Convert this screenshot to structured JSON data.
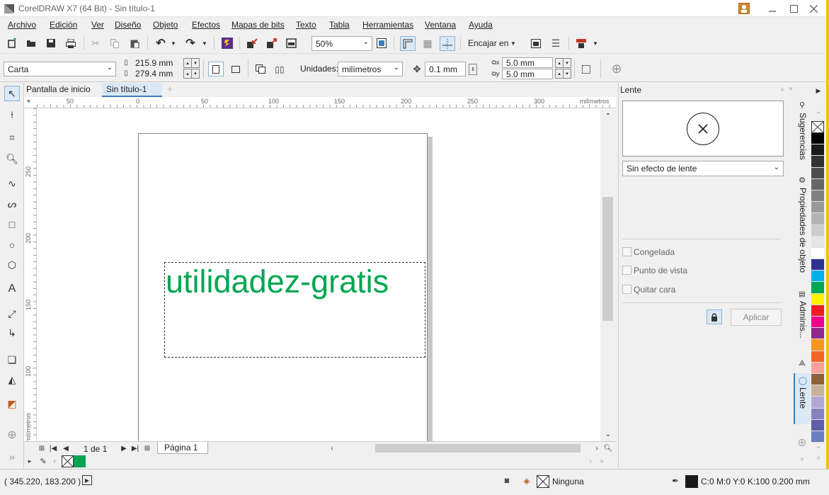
{
  "window": {
    "title": "CorelDRAW X7 (64 Bit) - Sin título-1"
  },
  "menu": [
    "Archivo",
    "Edición",
    "Ver",
    "Diseño",
    "Objeto",
    "Efectos",
    "Mapas de bits",
    "Texto",
    "Tabla",
    "Herramientas",
    "Ventana",
    "Ayuda"
  ],
  "toolbar": {
    "zoom": "50%",
    "snap_label": "Encajar en"
  },
  "propbar": {
    "paper": "Carta",
    "width": "215.9 mm",
    "height": "279.4 mm",
    "units_label": "Unidades:",
    "units_value": "milímetros",
    "nudge": "0.1 mm",
    "dup_x": "5.0 mm",
    "dup_y": "5.0 mm"
  },
  "tabs": {
    "home": "Pantalla de inicio",
    "doc": "Sin título-1"
  },
  "ruler": {
    "unit": "milímetros",
    "h_ticks": [
      "50",
      "0",
      "50",
      "100",
      "150",
      "200",
      "250",
      "300"
    ],
    "v_ticks": [
      "250",
      "200",
      "150",
      "100"
    ]
  },
  "canvas": {
    "text": "utilidadez-gratis",
    "text_color": "#00a651"
  },
  "pagenav": {
    "pages": "1 de 1",
    "page_tab": "Página 1"
  },
  "docker": {
    "title": "Lente",
    "dropdown": "Sin efecto de lente",
    "frozen": "Congelada",
    "viewpoint": "Punto de vista",
    "remove_face": "Quitar cara",
    "apply": "Aplicar"
  },
  "sidetabs": {
    "hints": "Sugerencias",
    "props": "Propiedades de objeto",
    "admin": "Adminis...",
    "lens": "Lente"
  },
  "status": {
    "coords": "( 345.220, 183.200 )",
    "fill_label": "Ninguna",
    "outline": "C:0 M:0 Y:0 K:100  0.200 mm"
  },
  "palette_colors": [
    "#ffffff",
    "#000000",
    "#1a1a1a",
    "#333333",
    "#4d4d4d",
    "#666666",
    "#808080",
    "#999999",
    "#b3b3b3",
    "#cccccc",
    "#e6e6e6",
    "#ffffff",
    "#2e3192",
    "#00aeef",
    "#00a651",
    "#fff200",
    "#ed1c24",
    "#ec008c",
    "#92278f",
    "#f7941d",
    "#f26522",
    "#f9a19a",
    "#8c6239",
    "#c7b299",
    "#b4a7d6",
    "#8781bd",
    "#605ca8",
    "#6a7fbf"
  ]
}
